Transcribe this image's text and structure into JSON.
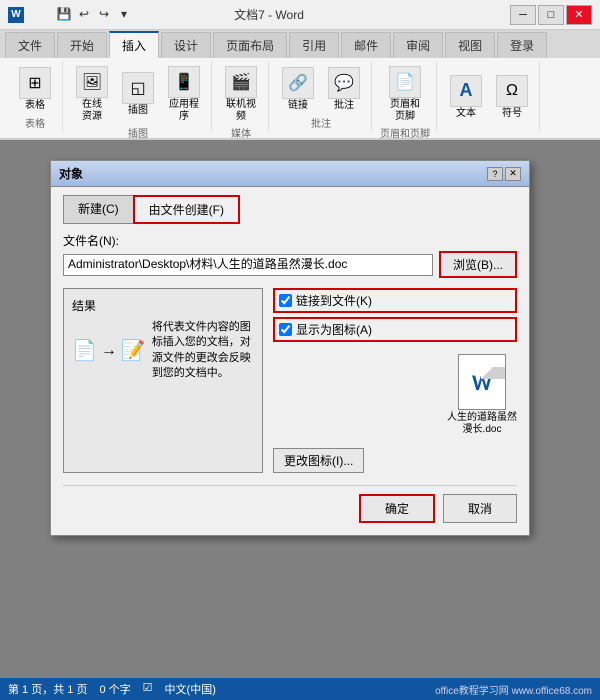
{
  "titlebar": {
    "title": "文档7 - Word",
    "icon_label": "W",
    "minimize_label": "─",
    "restore_label": "□",
    "close_label": "✕"
  },
  "quickaccess": {
    "save_label": "💾",
    "undo_label": "↩",
    "redo_label": "↪",
    "more_label": "▾"
  },
  "ribbon": {
    "tabs": [
      {
        "label": "文件",
        "active": false
      },
      {
        "label": "开始",
        "active": false
      },
      {
        "label": "插入",
        "active": true
      },
      {
        "label": "设计",
        "active": false
      },
      {
        "label": "页面布局",
        "active": false
      },
      {
        "label": "引用",
        "active": false
      },
      {
        "label": "邮件",
        "active": false
      },
      {
        "label": "审阅",
        "active": false
      },
      {
        "label": "视图",
        "active": false
      },
      {
        "label": "登录",
        "active": false
      }
    ],
    "groups": [
      {
        "label": "表格",
        "buttons": [
          {
            "icon": "⊞",
            "label": "表格"
          }
        ]
      },
      {
        "label": "插图",
        "buttons": [
          {
            "icon": "🖼",
            "label": "在线\n资源"
          },
          {
            "icon": "◱",
            "label": "插图"
          },
          {
            "icon": "📱",
            "label": "应用程\n序"
          }
        ]
      },
      {
        "label": "媒体",
        "buttons": [
          {
            "icon": "🎬",
            "label": "联机视\n频"
          }
        ]
      },
      {
        "label": "批注",
        "buttons": [
          {
            "icon": "🔗",
            "label": "链接"
          },
          {
            "icon": "💬",
            "label": "批注"
          }
        ]
      },
      {
        "label": "页眉和页脚",
        "buttons": [
          {
            "icon": "📄",
            "label": "页眉和页脚"
          }
        ]
      },
      {
        "label": "",
        "buttons": [
          {
            "icon": "A",
            "label": "文本"
          },
          {
            "icon": "Ω",
            "label": "符号"
          }
        ]
      }
    ]
  },
  "dialog": {
    "title": "对象",
    "help_btn": "?",
    "close_btn": "✕",
    "tabs": [
      {
        "label": "新建(C)",
        "active": false
      },
      {
        "label": "由文件创建(F)",
        "active": true
      }
    ],
    "file_name_label": "文件名(N):",
    "file_path": "Administrator\\Desktop\\材料\\人生的道路虽然漫长.doc",
    "browse_btn": "浏览(B)...",
    "checkboxes": [
      {
        "label": "链接到文件(K)",
        "checked": true
      },
      {
        "label": "显示为图标(A)",
        "checked": true
      }
    ],
    "result_section": {
      "label": "结果",
      "description": "将代表文件内容的图标插入您的文档，对源文件的更改会反映到您的文档中。"
    },
    "word_icon": {
      "letter": "W",
      "filename": "人生的道路虽然漫长.doc"
    },
    "change_icon_btn": "更改图标(I)...",
    "ok_btn": "确定",
    "cancel_btn": "取消"
  },
  "statusbar": {
    "page_info": "第 1 页，共 1 页",
    "word_count": "0 个字",
    "correction_icon": "☑",
    "language": "中文(中国)",
    "website": "www.office68.com",
    "site_label": "office教程学习网"
  }
}
